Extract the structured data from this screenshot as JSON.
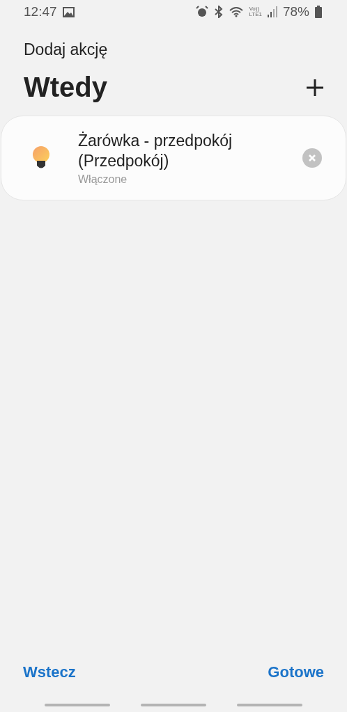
{
  "status_bar": {
    "time": "12:47",
    "volte": "Vo))",
    "network": "LTE1",
    "battery": "78%"
  },
  "header": {
    "title": "Dodaj akcję"
  },
  "section": {
    "title": "Wtedy"
  },
  "actions": [
    {
      "title": "Żarówka - przedpokój (Przedpokój)",
      "state": "Włączone",
      "on": true
    }
  ],
  "footer": {
    "back": "Wstecz",
    "done": "Gotowe"
  }
}
